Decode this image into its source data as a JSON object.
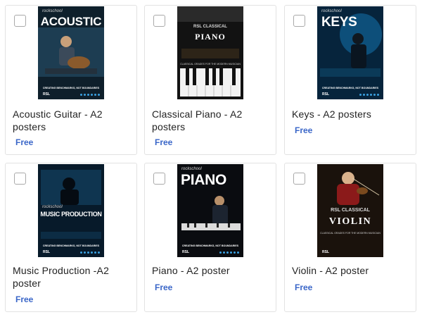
{
  "products": [
    {
      "title": "Acoustic Guitar - A2 posters",
      "price": "Free",
      "poster": {
        "brand": "rockschool",
        "heading": "ACOUSTIC",
        "tagline": "CREATING BENCHMARKS, NOT BOUNDARIES"
      }
    },
    {
      "title": "Classical Piano - A2 posters",
      "price": "Free",
      "poster": {
        "brand": "RSL CLASSICAL",
        "heading": "PIANO",
        "tagline": "CLASSICAL GRADES FOR THE MODERN MUSICIAN"
      }
    },
    {
      "title": "Keys - A2 posters",
      "price": "Free",
      "poster": {
        "brand": "rockschool",
        "heading": "KEYS",
        "tagline": "CREATING BENCHMARKS, NOT BOUNDARIES"
      }
    },
    {
      "title": "Music Production -A2 poster",
      "price": "Free",
      "poster": {
        "brand": "rockschool",
        "heading": "MUSIC PRODUCTION",
        "tagline": "CREATING BENCHMARKS, NOT BOUNDARIES"
      }
    },
    {
      "title": "Piano - A2 poster",
      "price": "Free",
      "poster": {
        "brand": "rockschool",
        "heading": "PIANO",
        "tagline": "CREATING BENCHMARKS, NOT BOUNDARIES"
      }
    },
    {
      "title": "Violin - A2 poster",
      "price": "Free",
      "poster": {
        "brand": "RSL CLASSICAL",
        "heading": "VIOLIN",
        "tagline": "CLASSICAL GRADES FOR THE MODERN MUSICIAN"
      }
    }
  ],
  "colors": {
    "price": "#3a66c8",
    "card_border": "#e2e2e2",
    "text": "#222222"
  },
  "icons": {
    "select": "checkbox-icon"
  }
}
